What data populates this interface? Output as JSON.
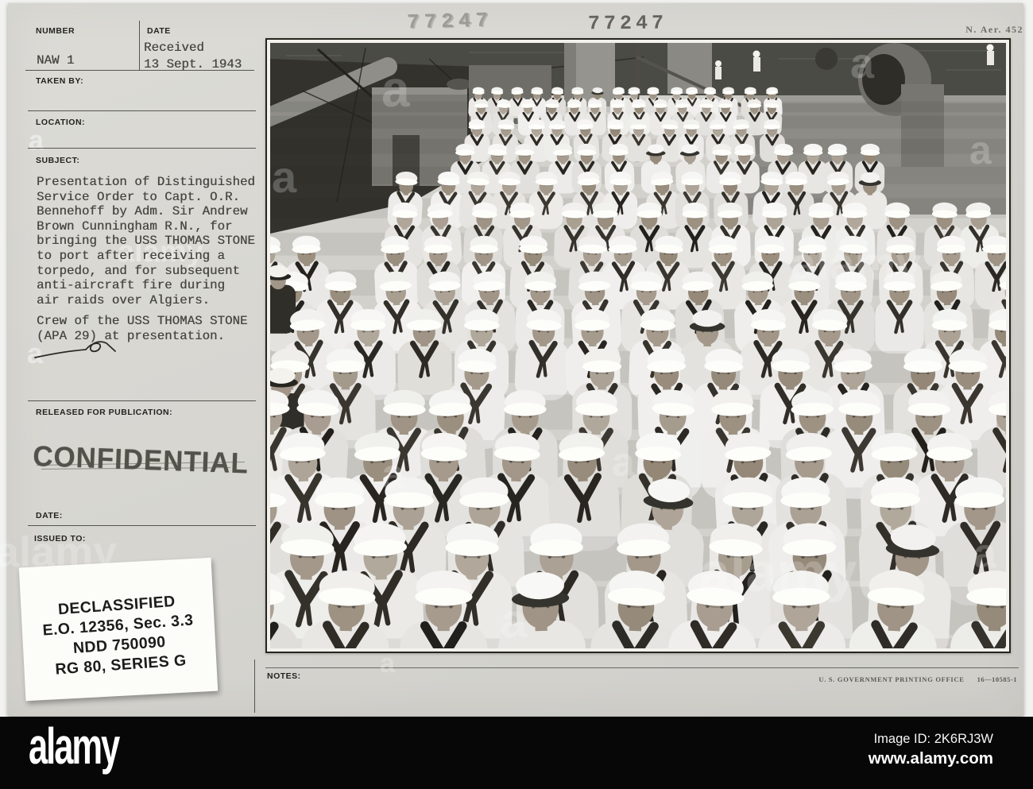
{
  "colors": {
    "card_bg": "#d6d5d0",
    "photo_mat": "#f2f1ec",
    "footer_bg": "#070707",
    "stamp_ink": "#1c1c1a",
    "typewriter_ink": "#45443f"
  },
  "card": {
    "header": {
      "number_label": "NUMBER",
      "number_value": "NAW 1",
      "date_label": "DATE",
      "date_value": "Received\n13 Sept. 1943",
      "taken_by_label": "TAKEN BY:",
      "location_label": "LOCATION:",
      "subject_label": "SUBJECT:"
    },
    "subject_text": "Presentation of Distinguished\nService Order to Capt. O.R.\nBennehoff by Adm. Sir Andrew\nBrown Cunningham R.N., for\nbringing the USS THOMAS STONE\nto port after receiving a\ntorpedo, and for subsequent\nanti-aircraft fire during\nair raids over Algiers.",
    "caption_text": "Crew of the USS THOMAS STONE\n(APA 29) at presentation.",
    "release": {
      "released_label": "RELEASED FOR PUBLICATION:",
      "confidential_stamp": "CONFIDENTIAL",
      "date_label": "DATE:",
      "issued_to_label": "ISSUED TO:"
    },
    "declassified_stamp": {
      "lines": [
        "DECLASSIFIED",
        "E.O. 12356, Sec. 3.3",
        "NDD 750090",
        "RG 80, SERIES G"
      ]
    },
    "photo_number_stamps": [
      "77247",
      "77247"
    ],
    "archive_ref": "N. Aer. 452",
    "notes_label": "NOTES:",
    "printer_credit": "U. S. GOVERNMENT PRINTING OFFICE",
    "printer_code": "16—10585-1"
  },
  "photo": {
    "description": "Crew of the USS THOMAS STONE (APA 29) in dress whites assembled on deck at the presentation ceremony"
  },
  "watermark": {
    "brand": "alamy",
    "image_id_label": "Image ID:",
    "image_id": "2K6RJ3W",
    "url": "www.alamy.com"
  }
}
